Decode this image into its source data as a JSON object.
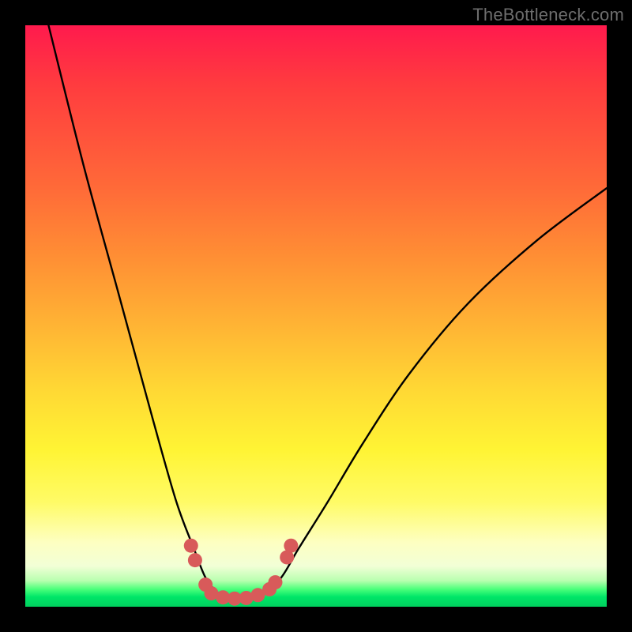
{
  "watermark": "TheBottleneck.com",
  "chart_data": {
    "type": "line",
    "title": "",
    "xlabel": "",
    "ylabel": "",
    "xlim": [
      0,
      100
    ],
    "ylim": [
      0,
      100
    ],
    "grid": false,
    "series": [
      {
        "name": "bottleneck-curve",
        "x": [
          4,
          10,
          16,
          22,
          26,
          29,
          31,
          33,
          35,
          38,
          41,
          44,
          47,
          52,
          58,
          66,
          76,
          88,
          100
        ],
        "values": [
          100,
          76,
          54,
          32,
          18,
          10,
          5,
          2.5,
          1.5,
          1.5,
          2.5,
          5,
          10,
          18,
          28,
          40,
          52,
          63,
          72
        ]
      }
    ],
    "markers": {
      "name": "highlight-dots",
      "color": "#d85a5a",
      "points": [
        {
          "x": 28.5,
          "y": 10.5
        },
        {
          "x": 29.2,
          "y": 8.0
        },
        {
          "x": 31.0,
          "y": 3.8
        },
        {
          "x": 32.0,
          "y": 2.3
        },
        {
          "x": 34.0,
          "y": 1.6
        },
        {
          "x": 36.0,
          "y": 1.4
        },
        {
          "x": 38.0,
          "y": 1.5
        },
        {
          "x": 40.0,
          "y": 2.0
        },
        {
          "x": 42.0,
          "y": 3.0
        },
        {
          "x": 43.0,
          "y": 4.2
        },
        {
          "x": 45.0,
          "y": 8.5
        },
        {
          "x": 45.7,
          "y": 10.5
        }
      ]
    }
  }
}
